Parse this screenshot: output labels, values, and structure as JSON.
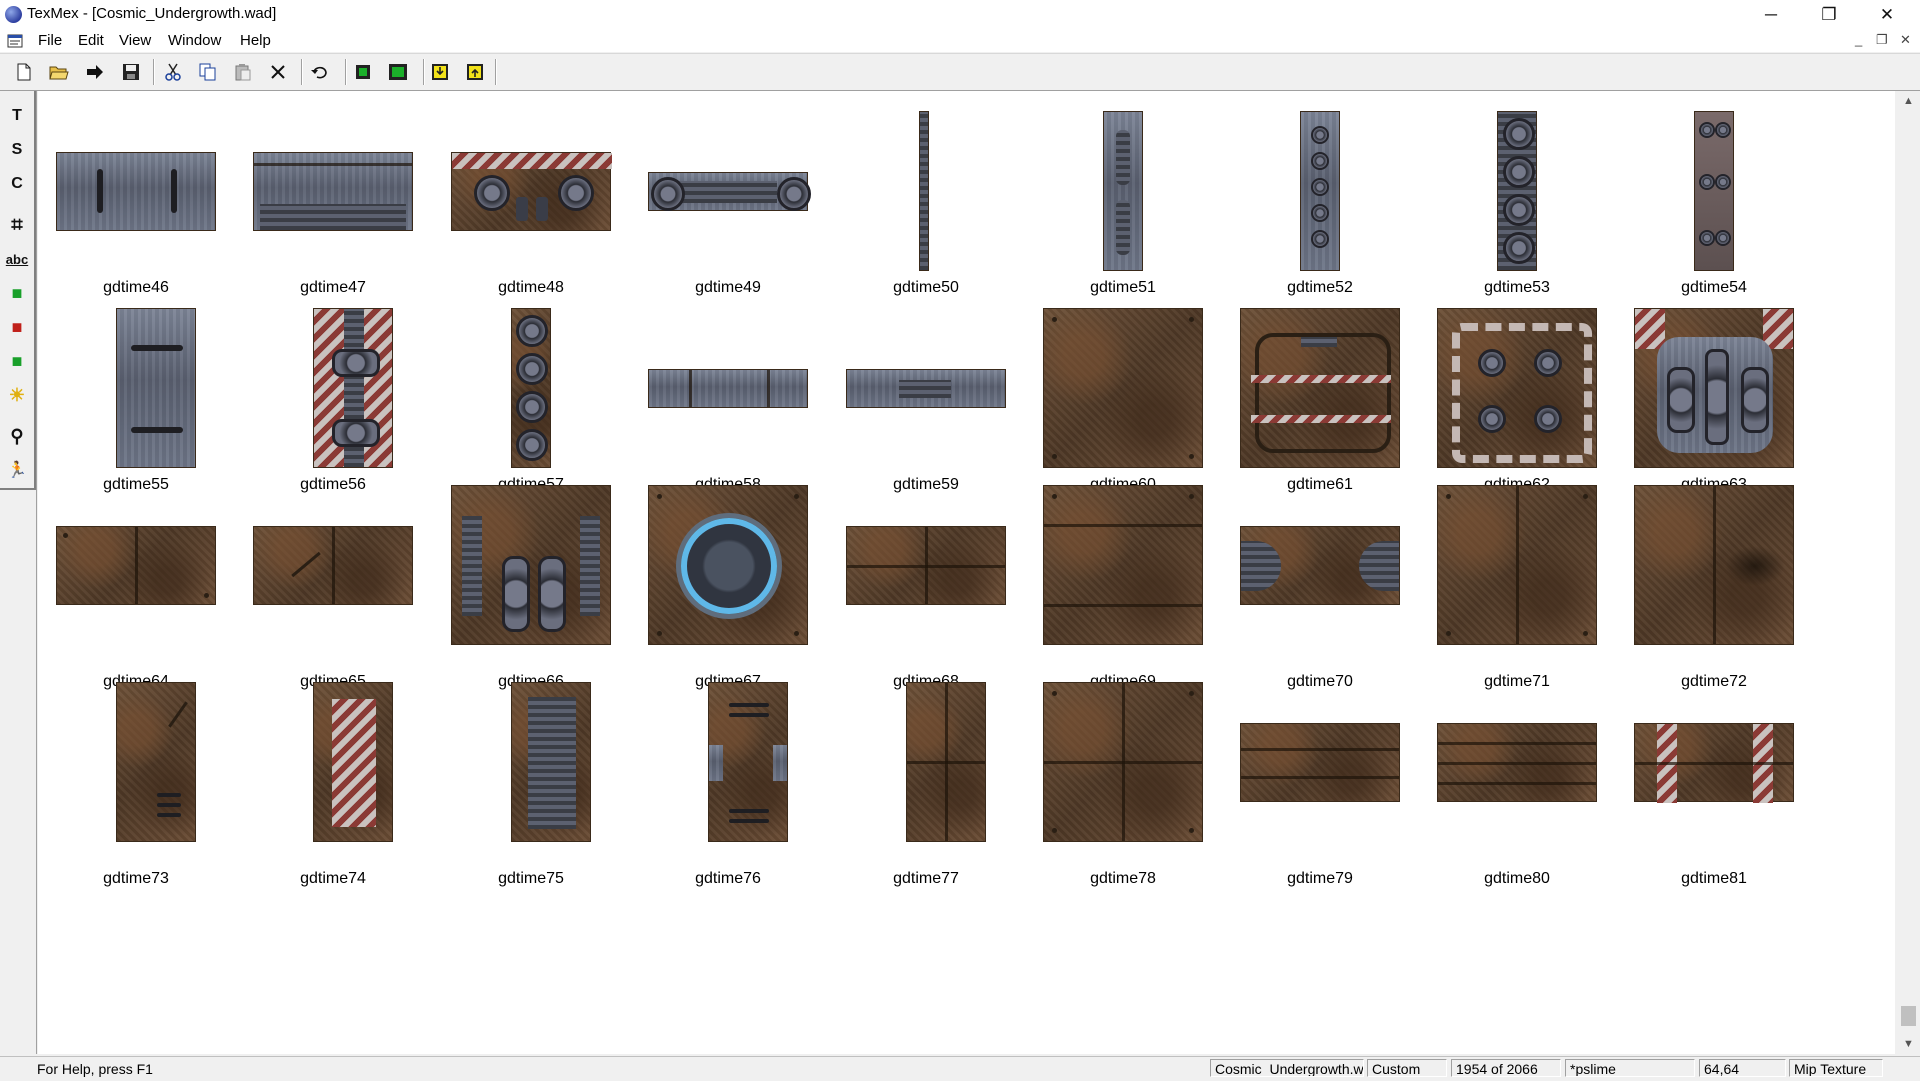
{
  "window": {
    "title": "TexMex - [Cosmic_Undergrowth.wad]",
    "minimize_glyph": "─",
    "restore_glyph": "❐",
    "close_glyph": "✕"
  },
  "menu": {
    "items": [
      "File",
      "Edit",
      "View",
      "Window",
      "Help"
    ],
    "mdi_minimize": "_",
    "mdi_restore": "❐",
    "mdi_close": "✕"
  },
  "toolbar": {
    "icons": [
      "new-file-icon",
      "open-folder-icon",
      "arrow-right-icon",
      "save-icon",
      "cut-icon",
      "copy-icon",
      "paste-icon",
      "delete-icon",
      "undo-icon",
      "green-square-icon",
      "fit-window-icon",
      "import-icon",
      "export-icon"
    ]
  },
  "tools": {
    "icons": [
      "text-tool-icon",
      "s-tool-icon",
      "c-tool-icon",
      "crop-icon",
      "abc-icon",
      "green-layers-icon",
      "green-red-icon",
      "red-green-icon",
      "sun-icon",
      "zoom-icon",
      "run-icon"
    ],
    "glyphs": [
      "T",
      "S",
      "C",
      "⌗",
      "abc",
      "■",
      "■",
      "■",
      "☀",
      "⚲",
      "🏃"
    ]
  },
  "textures": [
    {
      "name": "gdtime46"
    },
    {
      "name": "gdtime47"
    },
    {
      "name": "gdtime48"
    },
    {
      "name": "gdtime49"
    },
    {
      "name": "gdtime50"
    },
    {
      "name": "gdtime51"
    },
    {
      "name": "gdtime52"
    },
    {
      "name": "gdtime53"
    },
    {
      "name": "gdtime54"
    },
    {
      "name": "gdtime55"
    },
    {
      "name": "gdtime56"
    },
    {
      "name": "gdtime57"
    },
    {
      "name": "gdtime58"
    },
    {
      "name": "gdtime59"
    },
    {
      "name": "gdtime60"
    },
    {
      "name": "gdtime61"
    },
    {
      "name": "gdtime62"
    },
    {
      "name": "gdtime63"
    },
    {
      "name": "gdtime64"
    },
    {
      "name": "gdtime65"
    },
    {
      "name": "gdtime66"
    },
    {
      "name": "gdtime67"
    },
    {
      "name": "gdtime68"
    },
    {
      "name": "gdtime69"
    },
    {
      "name": "gdtime70"
    },
    {
      "name": "gdtime71"
    },
    {
      "name": "gdtime72"
    },
    {
      "name": "gdtime73"
    },
    {
      "name": "gdtime74"
    },
    {
      "name": "gdtime75"
    },
    {
      "name": "gdtime76"
    },
    {
      "name": "gdtime77"
    },
    {
      "name": "gdtime78"
    },
    {
      "name": "gdtime79"
    },
    {
      "name": "gdtime80"
    },
    {
      "name": "gdtime81"
    }
  ],
  "scrollbar": {
    "up_glyph": "▲",
    "down_glyph": "▼"
  },
  "statusbar": {
    "help": "For Help, press F1",
    "wad_name": "Cosmic_Undergrowth.wad",
    "palette": "Custom",
    "position": "1954 of 2066",
    "texture_name": "*pslime",
    "size": "64,64",
    "type": "Mip Texture"
  }
}
